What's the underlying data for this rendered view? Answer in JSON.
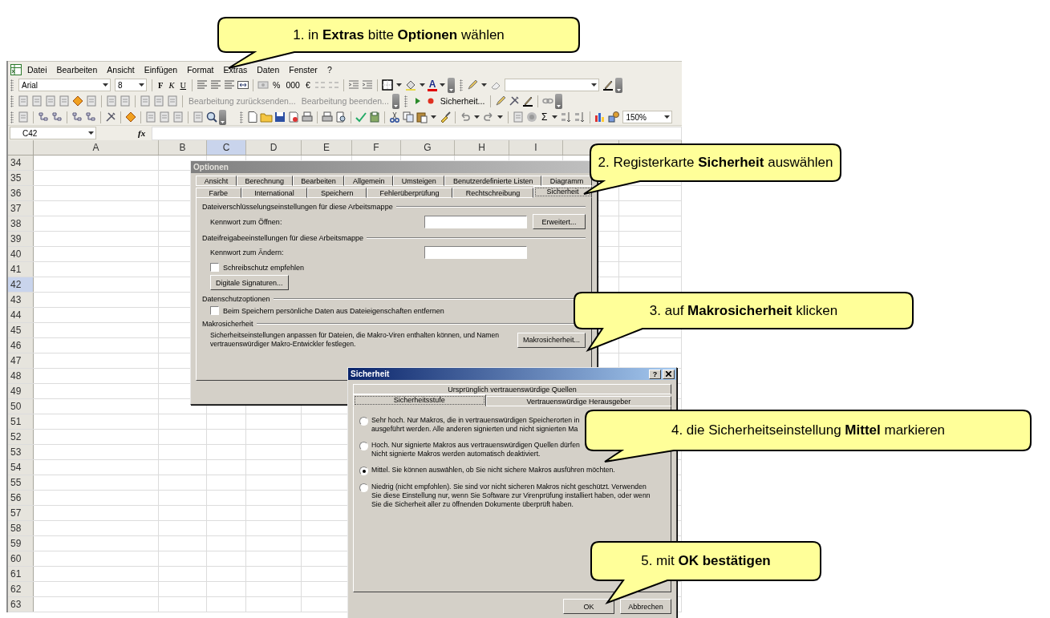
{
  "callouts": [
    {
      "text": "1. in **Extras** bitte **Optionen** wählen"
    },
    {
      "text": "2. Registerkarte **Sicherheit** auswählen"
    },
    {
      "text": "3. auf **Makrosicherheit** klicken"
    },
    {
      "text": "4. die Sicherheitseinstellung **Mittel** markieren"
    },
    {
      "text": "5. mit **OK bestätigen**"
    }
  ],
  "menu_bar": [
    "Datei",
    "Bearbeiten",
    "Ansicht",
    "Einfügen",
    "Format",
    "Extras",
    "Daten",
    "Fenster",
    "?"
  ],
  "formatting_toolbar": {
    "font": "Arial",
    "size": "8",
    "style_buttons": [
      "F",
      "K",
      "U"
    ],
    "number_buttons": [
      "%",
      "000",
      "€"
    ],
    "font_color_button": "A"
  },
  "reviewing_toolbar": {
    "buttons": [
      {
        "label": "Bearbeitung zurücksenden...",
        "disabled": true
      },
      {
        "label": "Bearbeitung beenden...",
        "disabled": true
      }
    ],
    "security_button": "Sicherheit..."
  },
  "standard_toolbar": {
    "autosum_button": "Σ",
    "zoom": "150%"
  },
  "formula_bar": {
    "name_box": "C42",
    "function_button": "fx"
  },
  "grid": {
    "columns": [
      {
        "label": "A",
        "selected": false
      },
      {
        "label": "B",
        "selected": false
      },
      {
        "label": "C",
        "selected": true
      },
      {
        "label": "D",
        "selected": false
      },
      {
        "label": "E",
        "selected": false
      },
      {
        "label": "F",
        "selected": false
      },
      {
        "label": "G",
        "selected": false
      },
      {
        "label": "H",
        "selected": false
      },
      {
        "label": "I",
        "selected": false
      }
    ],
    "rows": [
      {
        "label": "34",
        "selected": false
      },
      {
        "label": "35",
        "selected": false
      },
      {
        "label": "36",
        "selected": false
      },
      {
        "label": "37",
        "selected": false
      },
      {
        "label": "38",
        "selected": false
      },
      {
        "label": "39",
        "selected": false
      },
      {
        "label": "40",
        "selected": false
      },
      {
        "label": "41",
        "selected": false
      },
      {
        "label": "42",
        "selected": true
      },
      {
        "label": "43",
        "selected": false
      },
      {
        "label": "44",
        "selected": false
      },
      {
        "label": "45",
        "selected": false
      },
      {
        "label": "46",
        "selected": false
      },
      {
        "label": "47",
        "selected": false
      },
      {
        "label": "48",
        "selected": false
      },
      {
        "label": "49",
        "selected": false
      },
      {
        "label": "50",
        "selected": false
      },
      {
        "label": "51",
        "selected": false
      },
      {
        "label": "52",
        "selected": false
      },
      {
        "label": "53",
        "selected": false
      },
      {
        "label": "54",
        "selected": false
      },
      {
        "label": "55",
        "selected": false
      },
      {
        "label": "56",
        "selected": false
      },
      {
        "label": "57",
        "selected": false
      },
      {
        "label": "58",
        "selected": false
      },
      {
        "label": "59",
        "selected": false
      },
      {
        "label": "60",
        "selected": false
      },
      {
        "label": "61",
        "selected": false
      },
      {
        "label": "62",
        "selected": false
      },
      {
        "label": "63",
        "selected": false
      }
    ]
  },
  "options_dialog": {
    "title": "Optionen",
    "active": false,
    "tab_rows": [
      [
        {
          "label": "Ansicht",
          "selected": false
        },
        {
          "label": "Berechnung",
          "selected": false
        },
        {
          "label": "Bearbeiten",
          "selected": false
        },
        {
          "label": "Allgemein",
          "selected": false
        },
        {
          "label": "Umsteigen",
          "selected": false
        },
        {
          "label": "Benutzerdefinierte Listen",
          "selected": false
        },
        {
          "label": "Diagramm",
          "selected": false
        }
      ],
      [
        {
          "label": "Farbe",
          "selected": false
        },
        {
          "label": "International",
          "selected": false
        },
        {
          "label": "Speichern",
          "selected": false
        },
        {
          "label": "Fehlerüberprüfung",
          "selected": false
        },
        {
          "label": "Rechtschreibung",
          "selected": false
        },
        {
          "label": "Sicherheit",
          "selected": true
        }
      ]
    ],
    "encryption": {
      "heading": "Dateiverschlüsselungseinstellungen für diese Arbeitsmappe",
      "password_label": "Kennwort zum Öffnen:",
      "button": "Erweitert..."
    },
    "sharing": {
      "heading": "Dateifreigabeeinstellungen für diese Arbeitsmappe",
      "password_label": "Kennwort zum Ändern:",
      "checkbox": {
        "label": "Schreibschutz empfehlen",
        "checked": false
      },
      "button": "Digitale Signaturen..."
    },
    "privacy": {
      "heading": "Datenschutzoptionen",
      "checkbox": {
        "label": "Beim Speichern persönliche Daten aus Dateieigenschaften entfernen",
        "checked": false
      }
    },
    "macro": {
      "heading": "Makrosicherheit",
      "description": "Sicherheitseinstellungen anpassen für Dateien, die Makro-Viren enthalten können, und Namen vertrauenswürdiger Makro-Entwickler festlegen.",
      "button": "Makrosicherheit..."
    }
  },
  "security_dialog": {
    "title": "Sicherheit",
    "active": true,
    "help_button": "?",
    "tab_rows": [
      [
        {
          "label": "Ursprünglich vertrauenswürdige Quellen",
          "selected": false
        }
      ],
      [
        {
          "label": "Sicherheitsstufe",
          "selected": true
        },
        {
          "label": "Vertrauenswürdige Herausgeber",
          "selected": false
        }
      ]
    ],
    "options": [
      {
        "lines": [
          "Sehr hoch. Nur Makros, die in vertrauenswürdigen Speicherorten in",
          "ausgeführt werden. Alle anderen signierten und nicht signierten Ma"
        ],
        "selected": false
      },
      {
        "lines": [
          "Hoch. Nur signierte Makros aus vertrauenswürdigen Quellen dürfen",
          "Nicht signierte Makros werden automatisch deaktiviert."
        ],
        "selected": false
      },
      {
        "lines": [
          "Mittel. Sie können auswählen, ob Sie nicht sichere Makros ausführen möchten."
        ],
        "selected": true
      },
      {
        "lines": [
          "Niedrig (nicht empfohlen). Sie sind vor nicht sicheren Makros nicht geschützt. Verwenden",
          "Sie diese Einstellung nur, wenn Sie Software zur Virenprüfung installiert haben, oder wenn",
          "Sie die Sicherheit aller zu öffnenden Dokumente überprüft haben."
        ],
        "selected": false
      }
    ],
    "buttons": [
      "OK",
      "Abbrechen"
    ]
  }
}
